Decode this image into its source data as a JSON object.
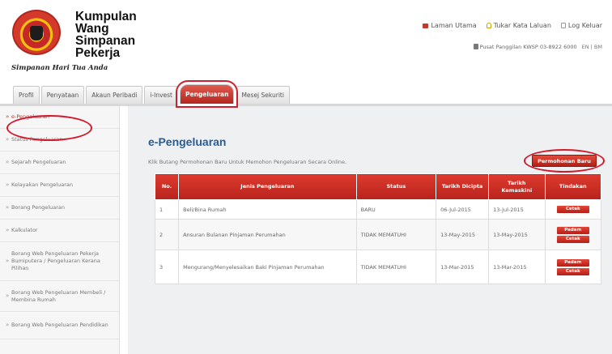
{
  "header": {
    "logo_lines": [
      "Kumpulan",
      "Wang",
      "Simpanan",
      "Pekerja"
    ],
    "tagline": "Simpanan Hari Tua Anda",
    "links": [
      {
        "label": "Laman Utama",
        "icon": "home-icon"
      },
      {
        "label": "Tukar Kata Laluan",
        "icon": "user-key-icon"
      },
      {
        "label": "Log Keluar",
        "icon": "lock-icon"
      }
    ],
    "contact_line": "Pusat Panggilan KWSP 03-8922 6000",
    "language": "EN | BM"
  },
  "tabs": [
    {
      "label": "Profil"
    },
    {
      "label": "Penyataan"
    },
    {
      "label": "Akaun Peribadi"
    },
    {
      "label": "i-Invest"
    },
    {
      "label": "Pengeluaran"
    },
    {
      "label": "Mesej Sekuriti"
    }
  ],
  "sidebar": {
    "items": [
      {
        "label": "e-Pengeluaran"
      },
      {
        "label": "Status Pengeluaran"
      },
      {
        "label": "Sejarah Pengeluaran"
      },
      {
        "label": "Kelayakan Pengeluaran"
      },
      {
        "label": "Borang Pengeluaran"
      },
      {
        "label": "Kalkulator"
      },
      {
        "label": "Borang Web Pengeluaran Pekerja Bumiputera / Pengeluaran Kerana Pilihan"
      },
      {
        "label": "Borang Web Pengeluaran Membeli / Membina Rumah"
      },
      {
        "label": "Borang Web Pengeluaran Pendidikan"
      }
    ]
  },
  "main": {
    "title": "e-Pengeluaran",
    "instruction": "Klik Butang Permohonan Baru Untuk Memohon Pengeluaran Secara Online.",
    "new_button": "Permohonan Baru",
    "table": {
      "headers": [
        "No.",
        "Jenis Pengeluaran",
        "Status",
        "Tarikh Dicipta",
        "Tarikh Kemaskini",
        "Tindakan"
      ],
      "rows": [
        {
          "no": "1",
          "jenis": "Beli/Bina Rumah",
          "status": "BARU",
          "dicipta": "06-Jul-2015",
          "kemaskini": "13-Jul-2015",
          "actions": [
            "Cetak"
          ]
        },
        {
          "no": "2",
          "jenis": "Ansuran Bulanan Pinjaman Perumahan",
          "status": "TIDAK MEMATUHI",
          "dicipta": "13-May-2015",
          "kemaskini": "13-May-2015",
          "actions": [
            "Padam",
            "Cetak"
          ]
        },
        {
          "no": "3",
          "jenis": "Mengurang/Menyelesaikan Baki Pinjaman Perumahan",
          "status": "TIDAK MEMATUHI",
          "dicipta": "13-Mar-2015",
          "kemaskini": "13-Mar-2015",
          "actions": [
            "Padam",
            "Cetak"
          ]
        }
      ]
    }
  },
  "colors": {
    "accent": "#c62828",
    "title_blue": "#2a5d93",
    "highlight_ring": "#d2182b"
  }
}
